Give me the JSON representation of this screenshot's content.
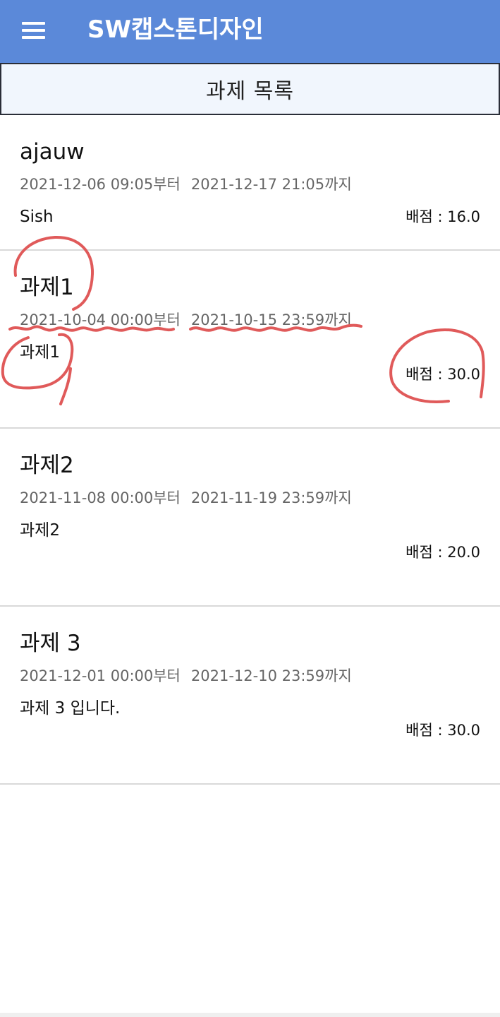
{
  "appbar": {
    "title": "SW캡스톤디자인",
    "menu_icon": "hamburger-menu-icon",
    "background_color": "#5b89d9"
  },
  "section": {
    "title": "과제 목록"
  },
  "assignments": [
    {
      "title": "ajauw",
      "start": "2021-12-06 09:05부터",
      "end": "2021-12-17 21:05까지",
      "description": "Sish",
      "score": "배점 : 16.0"
    },
    {
      "title": "과제1",
      "start": "2021-10-04 00:00부터",
      "end": "2021-10-15 23:59까지",
      "description": "과제1",
      "score": "배점 : 30.0"
    },
    {
      "title": "과제2",
      "start": "2021-11-08 00:00부터",
      "end": "2021-11-19 23:59까지",
      "description": "과제2",
      "score": "배점 : 20.0"
    },
    {
      "title": "과제 3",
      "start": "2021-12-01 00:00부터",
      "end": "2021-12-10 23:59까지",
      "description": "과제 3 입니다.",
      "score": "배점 : 30.0"
    }
  ],
  "annotation_color": "#e05a5a"
}
